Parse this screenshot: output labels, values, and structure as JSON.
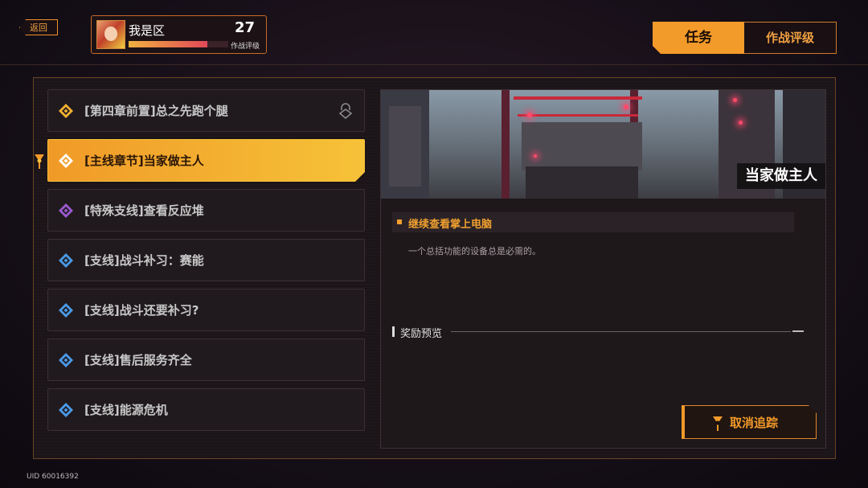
{
  "back_label": "返回",
  "profile": {
    "name": "我是区",
    "level": "27",
    "level_label": "作战评级",
    "xp_progress": 0.79
  },
  "tabs": [
    {
      "label": "任务",
      "active": true
    },
    {
      "label": "作战评级",
      "active": false
    }
  ],
  "quests": [
    {
      "label": "[第四章前置]总之先跑个腿",
      "type": "main-gold",
      "locked": true,
      "active": false
    },
    {
      "label": "[主线章节]当家做主人",
      "type": "main-gold",
      "locked": false,
      "active": true,
      "tracked": true
    },
    {
      "label": "[特殊支线]查看反应堆",
      "type": "special-purple",
      "locked": false,
      "active": false
    },
    {
      "label": "[支线]战斗补习：赛能",
      "type": "side-blue",
      "locked": false,
      "active": false
    },
    {
      "label": "[支线]战斗还要补习?",
      "type": "side-blue",
      "locked": false,
      "active": false
    },
    {
      "label": "[支线]售后服务齐全",
      "type": "side-blue",
      "locked": false,
      "active": false
    },
    {
      "label": "[支线]能源危机",
      "type": "side-blue",
      "locked": false,
      "active": false
    }
  ],
  "detail": {
    "banner_title": "当家做主人",
    "objective": "继续查看掌上电脑",
    "description": "一个总括功能的设备总是必需的。",
    "reward_label": "奖励预览",
    "untrack_label": "取消追踪"
  },
  "uid": "UID 60016392",
  "colors": {
    "accent": "#f29a2a",
    "gold": "#f6c238",
    "purple": "#9a5ad0",
    "blue": "#4a9ae8"
  }
}
